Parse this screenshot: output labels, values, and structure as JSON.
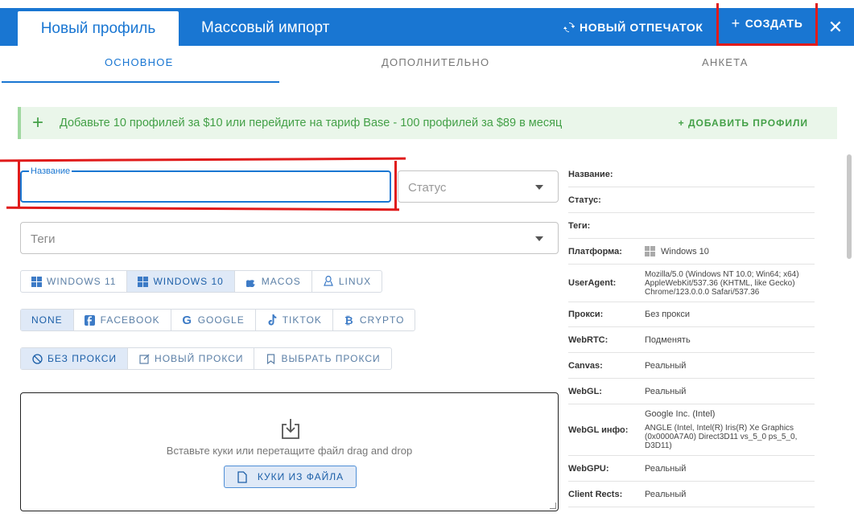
{
  "header": {
    "tab_new_profile": "Новый профиль",
    "tab_bulk_import": "Массовый импорт",
    "new_fingerprint": "НОВЫЙ ОТПЕЧАТОК",
    "create": "СОЗДАТЬ",
    "create_icon": "+",
    "close_icon": "✕",
    "accent": "#1976d2"
  },
  "subtabs": [
    "ОСНОВНОЕ",
    "ДОПОЛНИТЕЛЬНО",
    "АНКЕТА"
  ],
  "promo": {
    "icon": "+",
    "text": "Добавьте 10 профилей за $10 или перейдите на тариф Base - 100 профилей за $89 в месяц",
    "link": "+ ДОБАВИТЬ ПРОФИЛИ"
  },
  "form": {
    "name_label": "Название",
    "name_value": "",
    "status_placeholder": "Статус",
    "tags_placeholder": "Теги",
    "os_options": [
      "WINDOWS 11",
      "WINDOWS 10",
      "MACOS",
      "LINUX"
    ],
    "os_selected": "WINDOWS 10",
    "preset_options": [
      "NONE",
      "FACEBOOK",
      "GOOGLE",
      "TIKTOK",
      "CRYPTO"
    ],
    "preset_selected": "NONE",
    "proxy_options": [
      "БЕЗ ПРОКСИ",
      "НОВЫЙ ПРОКСИ",
      "ВЫБРАТЬ ПРОКСИ"
    ],
    "proxy_selected": "БЕЗ ПРОКСИ",
    "cookies_hint": "Вставьте куки или перетащите файл drag and drop",
    "cookies_button": "КУКИ ИЗ ФАЙЛА"
  },
  "summary": [
    {
      "key": "Название:",
      "value": ""
    },
    {
      "key": "Статус:",
      "value": ""
    },
    {
      "key": "Теги:",
      "value": ""
    },
    {
      "key": "Платформа:",
      "value": "Windows 10",
      "icon": "windows-icon"
    },
    {
      "key": "UserAgent:",
      "value": "Mozilla/5.0 (Windows NT 10.0; Win64; x64) AppleWebKit/537.36 (KHTML, like Gecko) Chrome/123.0.0.0 Safari/537.36"
    },
    {
      "key": "Прокси:",
      "value": "Без прокси"
    },
    {
      "key": "WebRTC:",
      "value": "Подменять"
    },
    {
      "key": "Canvas:",
      "value": "Реальный"
    },
    {
      "key": "WebGL:",
      "value": "Реальный"
    },
    {
      "key": "WebGL инфо:",
      "value": "Google Inc. (Intel)",
      "value2": "ANGLE (Intel, Intel(R) Iris(R) Xe Graphics (0x0000A7A0) Direct3D11 vs_5_0 ps_5_0, D3D11)"
    },
    {
      "key": "WebGPU:",
      "value": "Реальный"
    },
    {
      "key": "Client Rects:",
      "value": "Реальный"
    }
  ]
}
